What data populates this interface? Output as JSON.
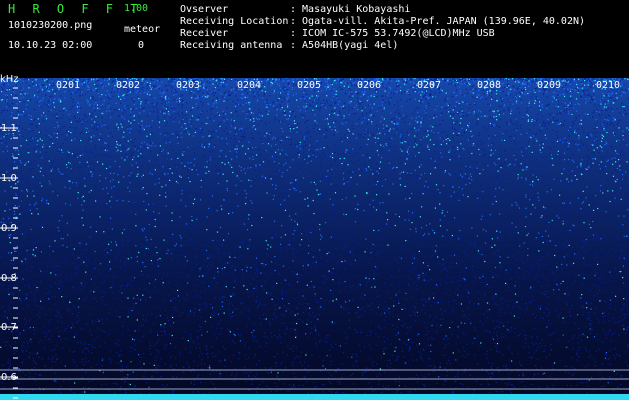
{
  "header": {
    "app_name": "H R O F F T",
    "version": "1.00",
    "filename": "1010230200.png",
    "datetime": "10.10.23 02:00",
    "meteor_label": "meteor",
    "meteor_count": "0"
  },
  "station": {
    "observer_label": "Ovserver",
    "observer_value": ": Masayuki Kobayashi",
    "location_label": "Receiving Location",
    "location_value": ": Ogata-vill. Akita-Pref. JAPAN (139.96E, 40.02N)",
    "receiver_label": "Receiver",
    "receiver_value": ": ICOM IC-575 53.7492(@LCD)MHz USB",
    "antenna_label": "Receiving antenna",
    "antenna_value": ": A504HB(yagi 4el)"
  },
  "spectrogram": {
    "unit": "kHz",
    "y_ticks": [
      "1.1",
      "1.0",
      "0.9",
      "0.8",
      "0.7",
      "0.6"
    ],
    "x_ticks": [
      "0201",
      "0202",
      "0203",
      "0204",
      "0205",
      "0206",
      "0207",
      "0208",
      "0209",
      "0210"
    ],
    "colors": {
      "background": "#000010",
      "signal_low": "#0a1e8c",
      "signal_mid": "#1e6cff",
      "signal_high": "#40f0f0",
      "text": "#ffffff"
    }
  }
}
